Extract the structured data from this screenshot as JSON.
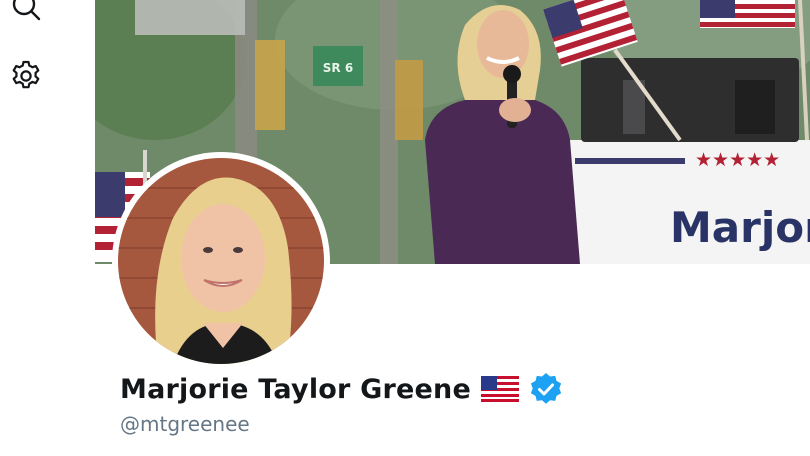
{
  "sidebar": {
    "items": [
      {
        "icon": "search-icon"
      },
      {
        "icon": "gear-icon"
      }
    ]
  },
  "banner": {
    "sign_text": "Marjorie",
    "sign_stars": "★★★★★",
    "street_sign": "SR 6"
  },
  "profile": {
    "name": "Marjorie Taylor Greene",
    "handle": "@mtgreenee",
    "flag_icon": "us-flag-emoji",
    "verified_icon": "verified-badge-icon",
    "verified_color": "#1da1f2",
    "name_color": "#14171a",
    "handle_color": "#657786"
  }
}
